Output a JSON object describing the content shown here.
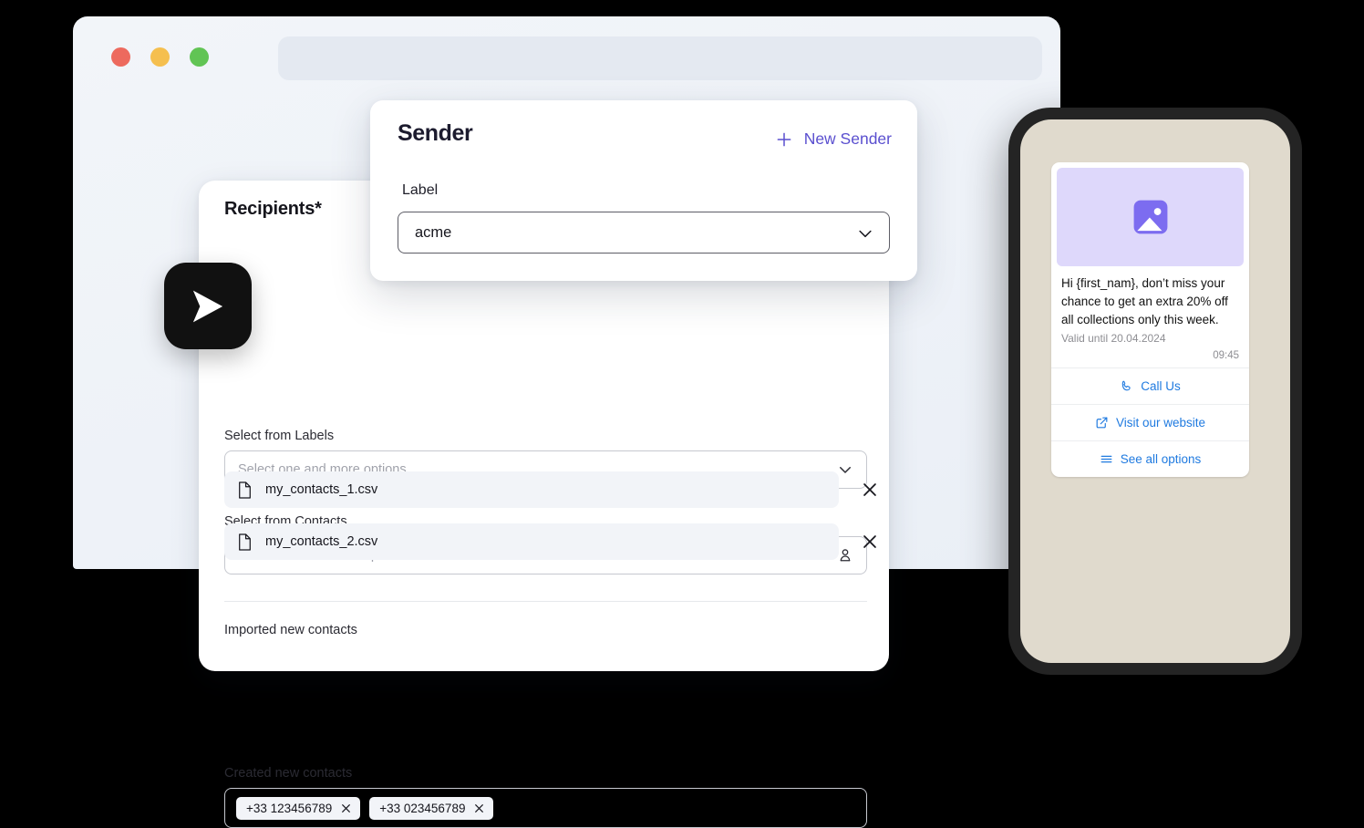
{
  "browser": {
    "traffic_lights": [
      "close",
      "minimize",
      "maximize"
    ],
    "url_bar_value": "",
    "url_bar_placeholder": ""
  },
  "sender_card": {
    "title": "Sender",
    "new_sender_label": "New Sender",
    "new_sender_icon": "plus-icon",
    "field_label": "Label",
    "select_value": "acme",
    "select_icon": "chevron-down-icon",
    "accent_color": "#5a4fcf"
  },
  "recipients_card": {
    "title": "Recipients*",
    "labels_field": {
      "label": "Select from Labels",
      "placeholder": "Select one and more options",
      "value": "",
      "icon": "chevron-down-icon"
    },
    "contacts_field": {
      "label": "Select from Contacts",
      "placeholder": "Select one and more options",
      "value": "",
      "icon": "person-icon"
    },
    "imported_section": {
      "label": "Imported new contacts",
      "files": [
        {
          "name": "my_contacts_1.csv",
          "icon": "file-icon",
          "remove_icon": "close-icon"
        },
        {
          "name": "my_contacts_2.csv",
          "icon": "file-icon",
          "remove_icon": "close-icon"
        }
      ]
    },
    "created_section": {
      "label": "Created new contacts",
      "chips": [
        {
          "value": "+33 123456789",
          "remove_icon": "close-icon"
        },
        {
          "value": "+33 023456789",
          "remove_icon": "close-icon"
        }
      ]
    }
  },
  "send_badge": {
    "icon": "send-arrow-icon",
    "background_color": "#111111"
  },
  "phone_preview": {
    "frame_color": "#242424",
    "screen_background": "#e0dacd",
    "message": {
      "media_icon": "image-placeholder-icon",
      "media_background": "#ded8fb",
      "body": "Hi {first_nam}, don’t miss your chance to get an extra 20% off all collections only this week.",
      "validity": "Valid until 20.04.2024",
      "time": "09:45",
      "link_color": "#1f7ae0",
      "actions": [
        {
          "label": "Call Us",
          "icon": "phone-icon"
        },
        {
          "label": "Visit our website",
          "icon": "external-link-icon"
        },
        {
          "label": "See all options",
          "icon": "list-icon"
        }
      ]
    }
  }
}
